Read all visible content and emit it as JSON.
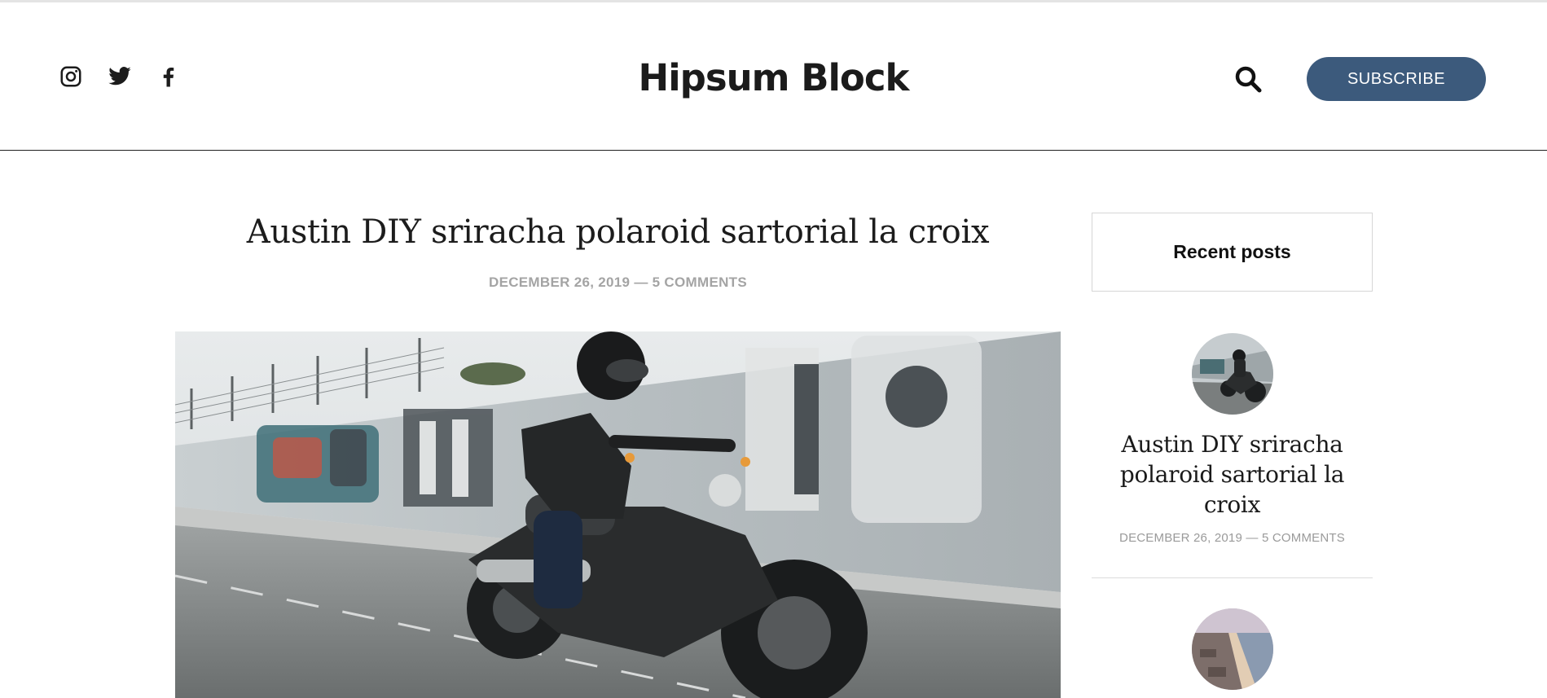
{
  "site": {
    "title": "Hipsum Block",
    "subscribe_label": "SUBSCRIBE",
    "social": [
      {
        "name": "instagram",
        "icon": "instagram-icon"
      },
      {
        "name": "twitter",
        "icon": "twitter-icon"
      },
      {
        "name": "facebook",
        "icon": "facebook-icon"
      }
    ],
    "search_icon": "search-icon",
    "accent_color": "#3c5a7c"
  },
  "post": {
    "title": "Austin DIY sriracha polaroid sartorial la croix",
    "date": "DECEMBER 26, 2019",
    "separator": " — ",
    "comments": "5 COMMENTS",
    "image": "motorcycle rider in front of graffiti wall"
  },
  "sidebar": {
    "widget_title": "Recent posts",
    "items": [
      {
        "title": "Austin DIY sriracha polaroid sartorial la croix",
        "date": "DECEMBER 26, 2019",
        "separator": " — ",
        "comments": "5 COMMENTS",
        "thumbnail": "motorcycle rider"
      },
      {
        "thumbnail": "aerial coastline"
      }
    ]
  }
}
